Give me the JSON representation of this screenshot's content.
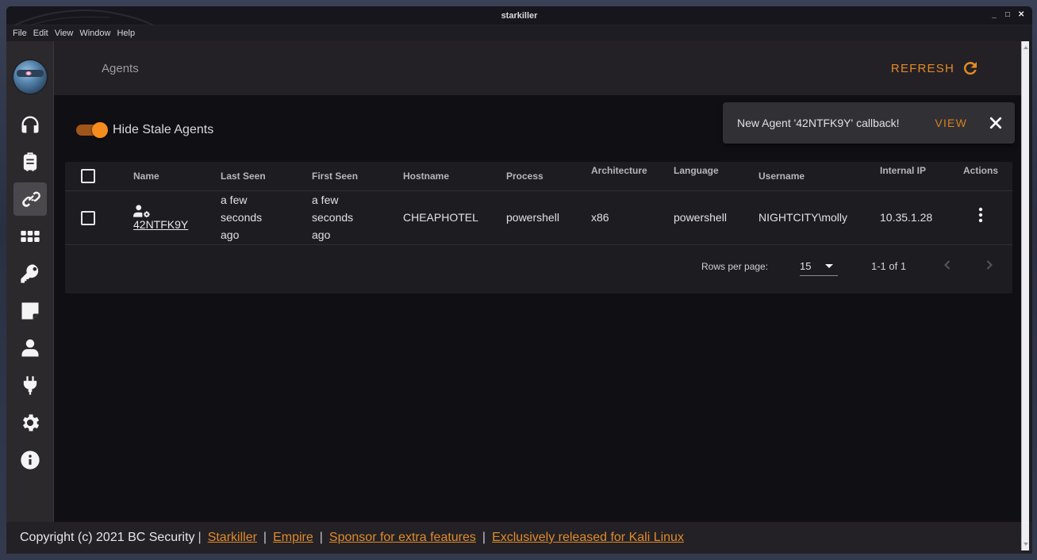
{
  "window": {
    "title": "starkiller",
    "controls": {
      "minimize": "_",
      "maximize": "□",
      "close": "✕"
    }
  },
  "menu": [
    "File",
    "Edit",
    "View",
    "Window",
    "Help"
  ],
  "sidebar": {
    "avatar": "starkiller-logo",
    "items": [
      {
        "id": "listeners",
        "icon": "headphones-icon",
        "active": false
      },
      {
        "id": "stagers",
        "icon": "suitcase-icon",
        "active": false
      },
      {
        "id": "agents",
        "icon": "link-icon",
        "active": true
      },
      {
        "id": "modules",
        "icon": "grid-icon",
        "active": false
      },
      {
        "id": "credentials",
        "icon": "key-icon",
        "active": false
      },
      {
        "id": "reporting",
        "icon": "note-icon",
        "active": false
      },
      {
        "id": "users",
        "icon": "user-icon",
        "active": false
      },
      {
        "id": "plugins",
        "icon": "plug-icon",
        "active": false
      },
      {
        "id": "settings",
        "icon": "gear-icon",
        "active": false
      },
      {
        "id": "about",
        "icon": "info-icon",
        "active": false
      }
    ]
  },
  "toolbar": {
    "page_title": "Agents",
    "refresh_label": "REFRESH"
  },
  "filters": {
    "hide_stale_label": "Hide Stale Agents",
    "hide_stale_on": true
  },
  "snackbar": {
    "message": "New Agent '42NTFK9Y' callback!",
    "action_label": "VIEW"
  },
  "table": {
    "headers": {
      "name": "Name",
      "last_seen": "Last Seen",
      "first_seen": "First Seen",
      "hostname": "Hostname",
      "process": "Process",
      "architecture": "Architecture",
      "language": "Language",
      "username": "Username",
      "internal_ip": "Internal IP",
      "actions": "Actions"
    },
    "rows": [
      {
        "name": "42NTFK9Y",
        "last_seen": "a few seconds ago",
        "first_seen": "a few seconds ago",
        "hostname": "CHEAPHOTEL",
        "process": "powershell",
        "architecture": "x86",
        "language": "powershell",
        "username": "NIGHTCITY\\molly",
        "internal_ip": "10.35.1.28"
      }
    ],
    "pagination": {
      "rows_per_page_label": "Rows per page:",
      "rows_per_page": "15",
      "range": "1-1 of 1"
    }
  },
  "footer": {
    "copyright": "Copyright (c) 2021 BC Security",
    "links": [
      "Starkiller",
      "Empire",
      "Sponsor for extra features",
      "Exclusively released for Kali Linux"
    ],
    "separator": "|"
  },
  "colors": {
    "accent": "#e58a24",
    "toggle_thumb": "#f68b1e",
    "background": "#100f13",
    "card": "#1d1c20"
  }
}
